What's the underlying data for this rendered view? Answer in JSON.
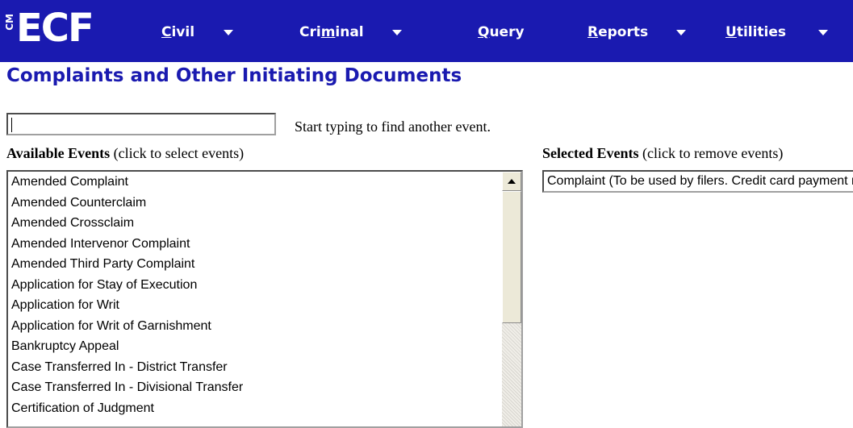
{
  "app": {
    "logo_prefix": "CM",
    "logo_text": "ECF"
  },
  "nav": {
    "items": [
      {
        "pre": "",
        "u": "C",
        "post": "ivil",
        "has_menu": true
      },
      {
        "pre": "Cri",
        "u": "m",
        "post": "inal",
        "has_menu": true
      },
      {
        "pre": "",
        "u": "Q",
        "post": "uery",
        "has_menu": false
      },
      {
        "pre": "",
        "u": "R",
        "post": "eports",
        "has_menu": true
      },
      {
        "pre": "",
        "u": "U",
        "post": "tilities",
        "has_menu": true
      }
    ]
  },
  "page": {
    "title": "Complaints and Other Initiating Documents"
  },
  "search": {
    "value": "",
    "hint": "Start typing to find another event."
  },
  "available": {
    "label_strong": "Available Events",
    "label_rest": " (click to select events)",
    "items": [
      "Amended Complaint",
      "Amended Counterclaim",
      "Amended Crossclaim",
      "Amended Intervenor Complaint",
      "Amended Third Party Complaint",
      "Application for Stay of Execution",
      "Application for Writ",
      "Application for Writ of Garnishment",
      "Bankruptcy Appeal",
      "Case Transferred In - District Transfer",
      "Case Transferred In - Divisional Transfer",
      "Certification of Judgment"
    ]
  },
  "selected": {
    "label_strong": "Selected Events",
    "label_rest": " (click to remove events)",
    "items": [
      "Complaint (To be used by filers. Credit card payment required)"
    ]
  },
  "colors": {
    "nav_background": "#1a1ab0",
    "title_text": "#1a1ab0"
  }
}
